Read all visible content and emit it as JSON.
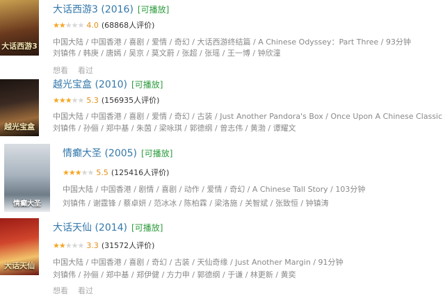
{
  "movies": [
    {
      "title": "大话西游3 (2016)",
      "playable": "[可播放]",
      "stars": "★★☆☆☆",
      "score": "4.0",
      "count": "(68868人评价)",
      "info": "中国大陆 / 中国香港 / 喜剧 / 爱情 / 奇幻 / 大话西游终结篇 / A Chinese Odyssey：Part Three / 93分钟",
      "cast": "刘镇伟 / 韩庚 / 唐嫣 / 吴京 / 莫文蔚 / 张超 / 张瑶 / 王一博 / 钟欣潼",
      "poster_text": "大话西游3"
    },
    {
      "title": "越光宝盒 (2010)",
      "playable": "[可播放]",
      "stars": "★★★☆☆",
      "score": "5.3",
      "count": "(156935人评价)",
      "info": "中国大陆 / 中国香港 / 喜剧 / 爱情 / 奇幻 / 古装 / Just Another Pandora's Box / Once Upon A Chinese Classic /",
      "cast": "刘镇伟 / 孙俪 / 郑中基 / 朱茵 / 梁咏琪 / 郭德纲 / 曾志伟 / 黄渤 / 谭耀文",
      "poster_text": "越光宝盒"
    },
    {
      "title": "情癫大圣 (2005)",
      "playable": "[可播放]",
      "stars": "★★★☆☆",
      "score": "5.5",
      "count": "(125416人评价)",
      "info": "中国大陆 / 中国香港 / 剧情 / 喜剧 / 动作 / 爱情 / 奇幻 / A Chinese Tall Story / 103分钟",
      "cast": "刘镇伟 / 谢霆锋 / 蔡卓妍 / 范冰冰 / 陈柏霖 / 梁洛施 / 关智斌 / 张致恒 / 钟镇涛",
      "poster_text": "情癫大圣"
    },
    {
      "title": "大话天仙 (2014)",
      "playable": "[可播放]",
      "stars": "★★☆☆☆",
      "score": "3.3",
      "count": "(31572人评价)",
      "info": "中国大陆 / 中国香港 / 喜剧 / 奇幻 / 古装 / 天仙奇缘 / Just Another Margin / 91分钟",
      "cast": "刘镇伟 / 孙俪 / 郑中基 / 郑伊健 / 方力申 / 郭德纲 / 于谦 / 林更新 / 黄奕",
      "poster_text": "大话天仙"
    }
  ],
  "actions": {
    "want": "想看",
    "seen": "看过"
  }
}
